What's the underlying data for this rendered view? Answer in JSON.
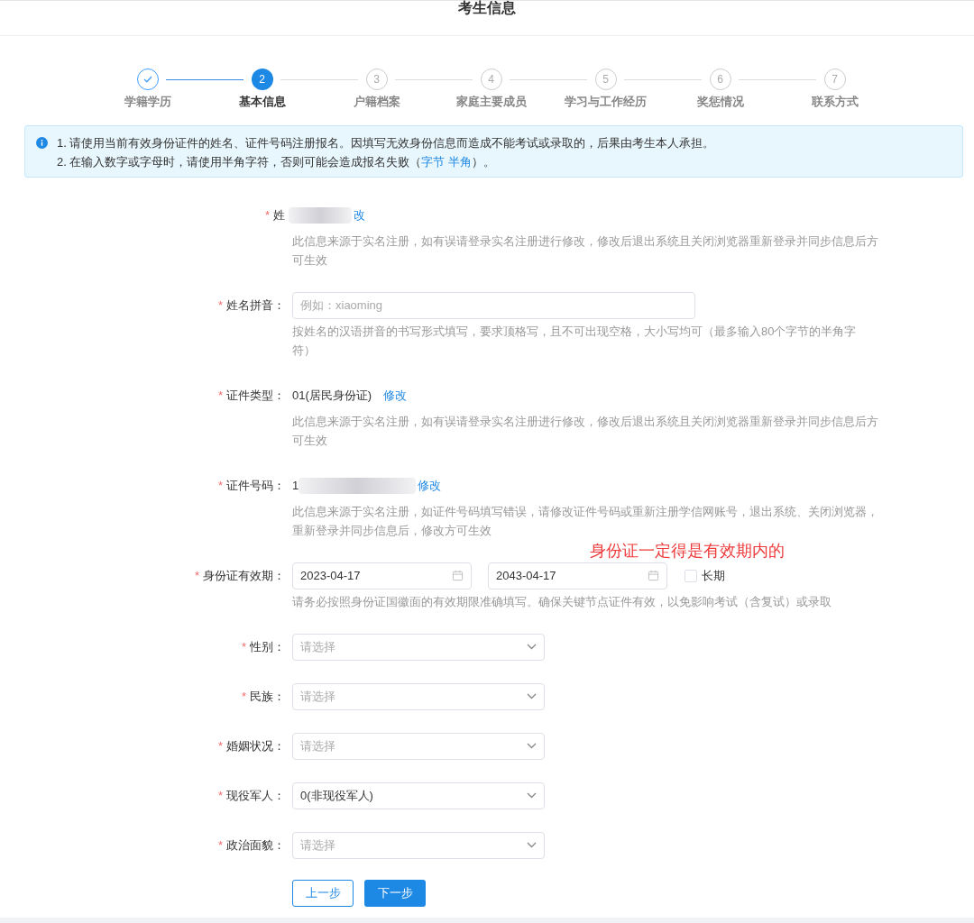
{
  "header": {
    "title": "考生信息"
  },
  "steps": [
    {
      "label": "学籍学历",
      "done": true,
      "selected": false
    },
    {
      "number": "2",
      "label": "基本信息",
      "done": false,
      "selected": true
    },
    {
      "number": "3",
      "label": "户籍档案",
      "done": false,
      "selected": false
    },
    {
      "number": "4",
      "label": "家庭主要成员",
      "done": false,
      "selected": false
    },
    {
      "number": "5",
      "label": "学习与工作经历",
      "done": false,
      "selected": false
    },
    {
      "number": "6",
      "label": "奖惩情况",
      "done": false,
      "selected": false
    },
    {
      "number": "7",
      "label": "联系方式",
      "done": false,
      "selected": false
    }
  ],
  "notice": {
    "line_1": "1. 请使用当前有效身份证件的姓名、证件号码注册报名。因填写无效身份信息而造成不能考试或录取的，后果由考生本人承担。",
    "line_2_before": "2. 在输入数字或字母时，请使用半角字符，否则可能会造成报名失败（",
    "line_2_link": "字节 半角",
    "line_2_after": "）。"
  },
  "fields": [
    {
      "kind": "readonly",
      "required_mark": "*",
      "label": "姓",
      "redacted": true,
      "link": "改",
      "hint": "此信息来源于实名注册，如有误请登录实名注册进行修改，修改后退出系统且关闭浏览器重新登录并同步信息后方可生效"
    },
    {
      "kind": "text",
      "required_mark": "*",
      "label": "姓名拼音：",
      "placeholder": "例如：xiaoming",
      "hint": "按姓名的汉语拼音的书写形式填写，要求顶格写，且不可出现空格，大小写均可（最多输入80个字节的半角字符）"
    },
    {
      "kind": "readonly",
      "required_mark": "*",
      "label": "证件类型：",
      "value": "01(居民身份证)",
      "link": "修改",
      "hint": "此信息来源于实名注册，如有误请登录实名注册进行修改，修改后退出系统且关闭浏览器重新登录并同步信息后方可生效"
    },
    {
      "kind": "readonly",
      "required_mark": "*",
      "label": "证件号码：",
      "value": "1",
      "redacted": true,
      "link": "修改",
      "hint": "此信息来源于实名注册，如证件号码填写错误，请修改证件号码或重新注册学信网账号，退出系统、关闭浏览器，重新登录并同步信息后，修改方可生效"
    },
    {
      "kind": "daterange",
      "required_mark": "*",
      "label": "身份证有效期：",
      "start": "2023-04-17",
      "end": "2043-04-17",
      "checkbox_label": "长期",
      "checked": false,
      "annotation": "身份证一定得是有效期内的",
      "hint": "请务必按照身份证国徽面的有效期限准确填写。确保关键节点证件有效，以免影响考试（含复试）或录取"
    },
    {
      "kind": "select",
      "required_mark": "*",
      "label": "性别：",
      "placeholder": "请选择"
    },
    {
      "kind": "select",
      "required_mark": "*",
      "label": "民族：",
      "placeholder": "请选择"
    },
    {
      "kind": "select",
      "required_mark": "*",
      "label": "婚姻状况：",
      "placeholder": "请选择"
    },
    {
      "kind": "select",
      "required_mark": "*",
      "label": "现役军人：",
      "value": "0(非现役军人)"
    },
    {
      "kind": "select",
      "required_mark": "*",
      "label": "政治面貌：",
      "placeholder": "请选择"
    }
  ],
  "buttons": {
    "previous": "上一步",
    "next": "下一步"
  }
}
